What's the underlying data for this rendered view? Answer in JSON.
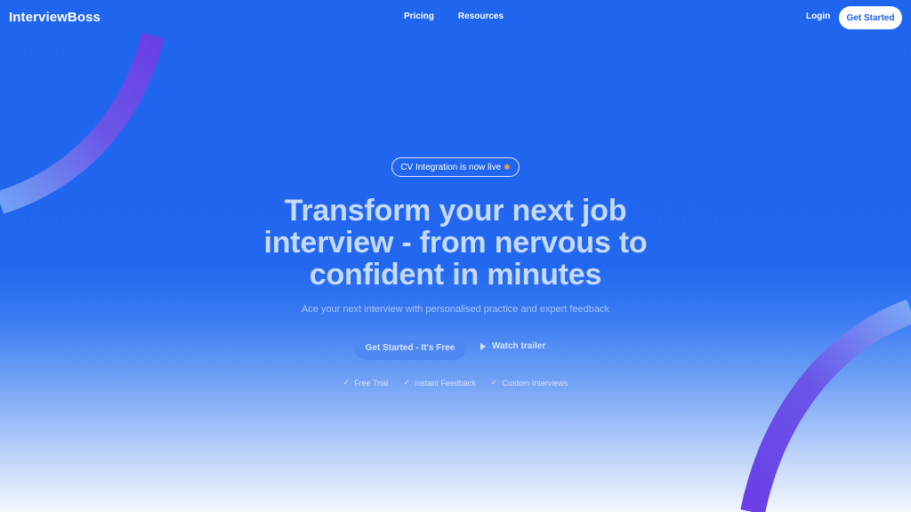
{
  "nav": {
    "logo": "InterviewBoss",
    "links": [
      {
        "label": "Pricing"
      },
      {
        "label": "Resources"
      }
    ],
    "login": "Login",
    "cta": "Get Started"
  },
  "hero": {
    "badge": {
      "text": "CV Integration is now live",
      "icon": "party-popper-icon"
    },
    "headline": [
      "Transform your next job",
      "interview - from nervous to",
      "confident in minutes"
    ],
    "subtitle": "Ace your next interview with personalised practice and expert feedback",
    "primary_cta": "Get Started - It's Free",
    "secondary_cta": {
      "label": "Watch trailer",
      "icon": "play-icon"
    },
    "features": [
      {
        "label": "Free Trial",
        "icon": "check-icon"
      },
      {
        "label": "Instant Feedback",
        "icon": "check-icon"
      },
      {
        "label": "Custom Interviews",
        "icon": "check-icon"
      }
    ]
  },
  "colors": {
    "primary_blue": "#2065ee",
    "ring_purple": "#6a3fe6",
    "white": "#ffffff"
  }
}
